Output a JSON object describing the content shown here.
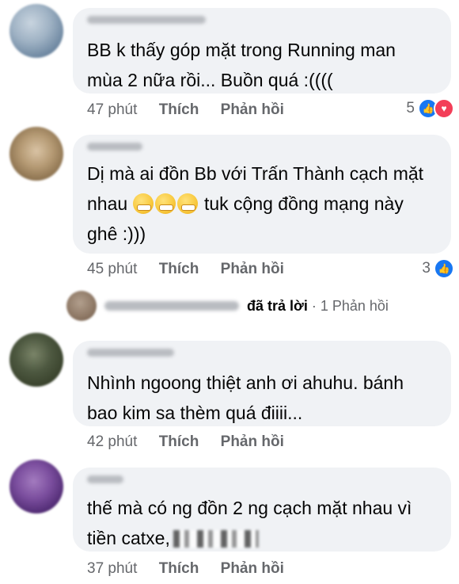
{
  "comments": [
    {
      "text_lines": [
        "BB k thấy góp mặt trong Running man",
        "mùa 2 nữa rồi... Buồn quá :(((("
      ],
      "time": "47 phút",
      "like_label": "Thích",
      "reply_label": "Phản hồi",
      "reaction_count": "5",
      "reactions": [
        "like-icon",
        "love-icon"
      ]
    },
    {
      "text_lines": [
        "Dị mà ai đồn Bb với Trấn Thành cạch mặt",
        "tuk cộng đồng mạng này",
        "ghê :)))"
      ],
      "line2_prefix": "nhau",
      "emoji_count": 3,
      "time": "45 phút",
      "like_label": "Thích",
      "reply_label": "Phản hồi",
      "reaction_count": "3",
      "reactions": [
        "like-icon"
      ]
    },
    {
      "text_lines": [
        "Nhình ngoong thiệt anh ơi ahuhu.  bánh",
        "bao kim sa thèm quá điiii..."
      ],
      "time": "42 phút",
      "like_label": "Thích",
      "reply_label": "Phản hồi"
    },
    {
      "text_lines": [
        "thế mà có ng đồn 2 ng cạch mặt nhau vì",
        "tiền catxe,"
      ],
      "time": "37 phút",
      "like_label": "Thích",
      "reply_label": "Phản hồi"
    }
  ],
  "reply_summary": {
    "action": "đã trả lời",
    "separator": "·",
    "count_label": "1 Phản hồi"
  },
  "colors": {
    "bubble": "#f0f2f5",
    "meta_text": "#65676b",
    "like": "#1877f2",
    "love": "#f33e58"
  }
}
